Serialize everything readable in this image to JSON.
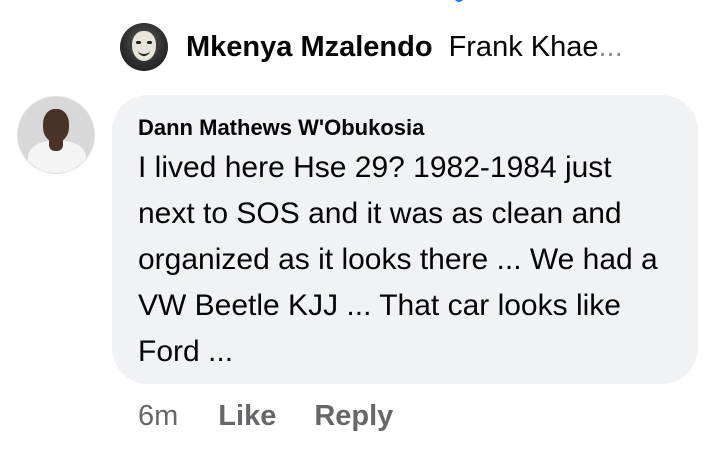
{
  "colors": {
    "bubble_bg": "#f0f2f5",
    "secondary_text": "#65676b",
    "primary_text": "#050505",
    "link_blue": "#1877f2"
  },
  "reply_preview": {
    "avatar_icon": "masked-face-avatar",
    "name": "Mkenya Mzalendo",
    "text": "Frank Khae",
    "ellipsis": "..."
  },
  "comment": {
    "avatar_icon": "person-photo-avatar",
    "author": "Dann Mathews W'Obukosia",
    "text": "I lived here Hse 29? 1982-1984 just next to SOS and it was as clean and organized as it looks there ... We had a VW Beetle KJJ ... That car looks like Ford ..."
  },
  "actions": {
    "time": "6m",
    "like_label": "Like",
    "reply_label": "Reply"
  }
}
